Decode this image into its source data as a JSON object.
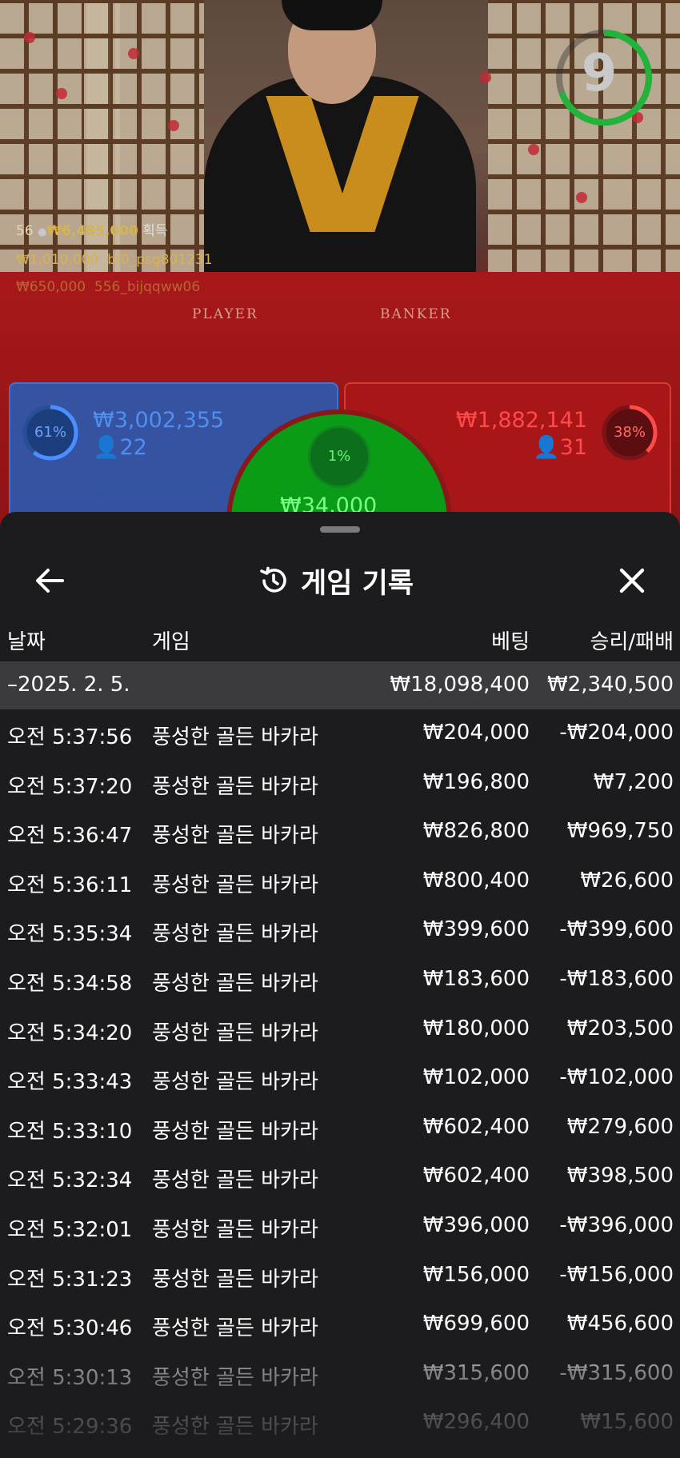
{
  "game": {
    "timer": "9",
    "table_labels": [
      "PLAYER",
      "BANKER"
    ],
    "winners": {
      "count": "56",
      "total": "₩6,485,000",
      "label": "획득",
      "entries": [
        {
          "amount": "₩1,010,000",
          "user": "bf0_psg801231"
        },
        {
          "amount": "₩650,000",
          "user": "556_bijqqww06"
        }
      ]
    },
    "player": {
      "amount": "₩3,002,355",
      "players": "22",
      "pct": "61%",
      "pct_value": 0.61,
      "color": "#4a8fff"
    },
    "banker": {
      "amount": "₩1,882,141",
      "players": "31",
      "pct": "38%",
      "pct_value": 0.38,
      "color": "#ff4a4a"
    },
    "tie": {
      "pct": "1%",
      "amount": "₩34,000"
    }
  },
  "sheet": {
    "title": "게임 기록",
    "columns": {
      "date": "날짜",
      "game": "게임",
      "bet": "베팅",
      "result": "승리/패배"
    },
    "day": {
      "date": "–2025. 2. 5.",
      "bet": "₩18,098,400",
      "result": "₩2,340,500"
    },
    "rows": [
      {
        "time": "오전 5:37:56",
        "game": "풍성한 골든 바카라",
        "bet": "₩204,000",
        "result": "-₩204,000"
      },
      {
        "time": "오전 5:37:20",
        "game": "풍성한 골든 바카라",
        "bet": "₩196,800",
        "result": "₩7,200"
      },
      {
        "time": "오전 5:36:47",
        "game": "풍성한 골든 바카라",
        "bet": "₩826,800",
        "result": "₩969,750"
      },
      {
        "time": "오전 5:36:11",
        "game": "풍성한 골든 바카라",
        "bet": "₩800,400",
        "result": "₩26,600"
      },
      {
        "time": "오전 5:35:34",
        "game": "풍성한 골든 바카라",
        "bet": "₩399,600",
        "result": "-₩399,600"
      },
      {
        "time": "오전 5:34:58",
        "game": "풍성한 골든 바카라",
        "bet": "₩183,600",
        "result": "-₩183,600"
      },
      {
        "time": "오전 5:34:20",
        "game": "풍성한 골든 바카라",
        "bet": "₩180,000",
        "result": "₩203,500"
      },
      {
        "time": "오전 5:33:43",
        "game": "풍성한 골든 바카라",
        "bet": "₩102,000",
        "result": "-₩102,000"
      },
      {
        "time": "오전 5:33:10",
        "game": "풍성한 골든 바카라",
        "bet": "₩602,400",
        "result": "₩279,600"
      },
      {
        "time": "오전 5:32:34",
        "game": "풍성한 골든 바카라",
        "bet": "₩602,400",
        "result": "₩398,500"
      },
      {
        "time": "오전 5:32:01",
        "game": "풍성한 골든 바카라",
        "bet": "₩396,000",
        "result": "-₩396,000"
      },
      {
        "time": "오전 5:31:23",
        "game": "풍성한 골든 바카라",
        "bet": "₩156,000",
        "result": "-₩156,000"
      },
      {
        "time": "오전 5:30:46",
        "game": "풍성한 골든 바카라",
        "bet": "₩699,600",
        "result": "₩456,600"
      },
      {
        "time": "오전 5:30:13",
        "game": "풍성한 골든 바카라",
        "bet": "₩315,600",
        "result": "-₩315,600"
      },
      {
        "time": "오전 5:29:36",
        "game": "풍성한 골든 바카라",
        "bet": "₩296,400",
        "result": "₩15,600"
      }
    ]
  }
}
